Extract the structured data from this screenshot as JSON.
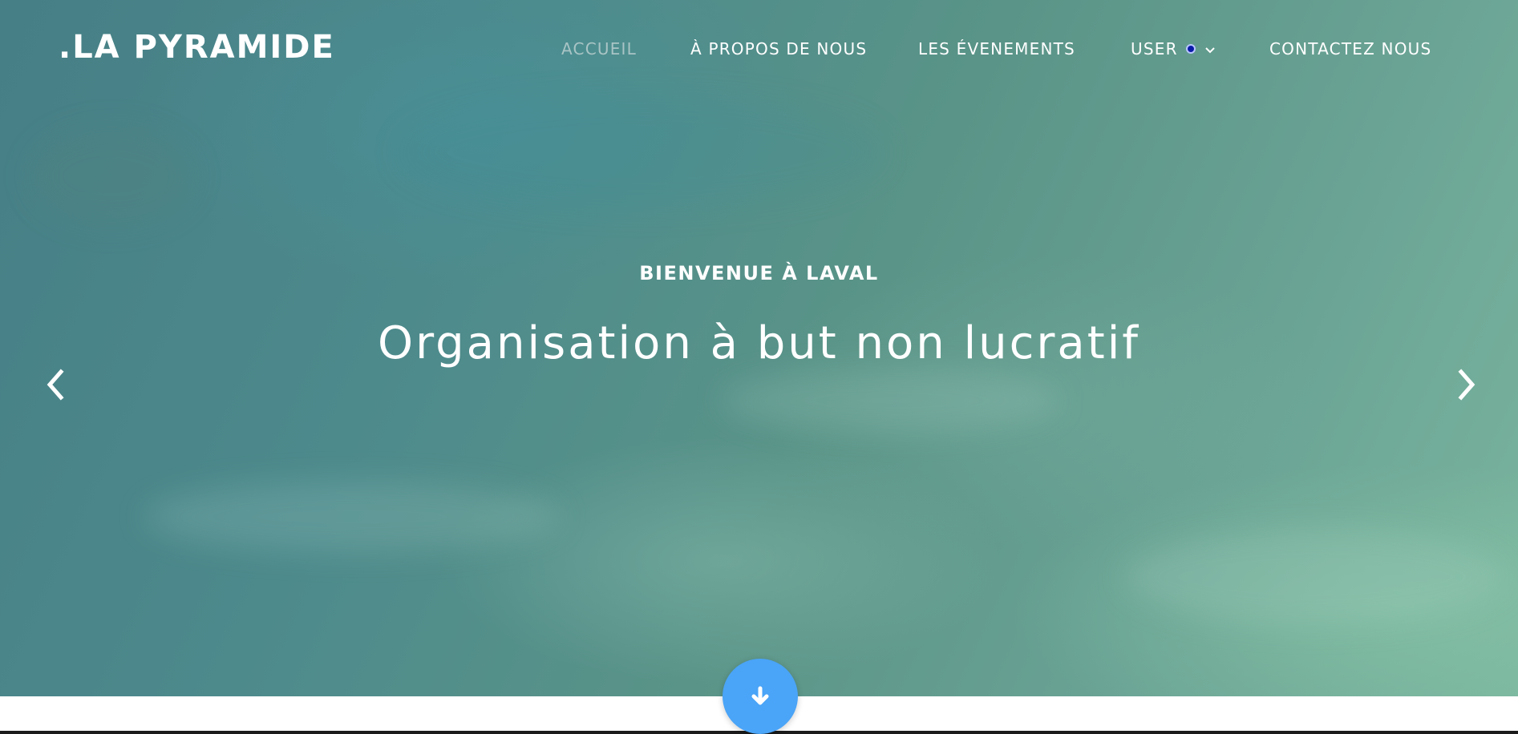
{
  "brand": {
    "logo_text": ".LA PYRAMIDE"
  },
  "nav": {
    "items": [
      {
        "label": "ACCUEIL",
        "active": true
      },
      {
        "label": "À PROPOS DE NOUS",
        "active": false
      },
      {
        "label": "LES ÉVENEMENTS",
        "active": false
      },
      {
        "label": "USER",
        "active": false,
        "has_dropdown": true
      },
      {
        "label": "CONTACTEZ NOUS",
        "active": false
      }
    ]
  },
  "hero": {
    "subtitle": "BIENVENUE À LAVAL",
    "title": "Organisation à but non lucratif",
    "prev_icon": "chevron-left-icon",
    "next_icon": "chevron-right-icon"
  },
  "scroll_button": {
    "icon": "arrow-down-icon",
    "color": "#4aa4f7"
  },
  "colors": {
    "nav_active": "#a9c4c5",
    "nav_text": "#ffffff",
    "user_status_dot": "#0a1aa8"
  }
}
